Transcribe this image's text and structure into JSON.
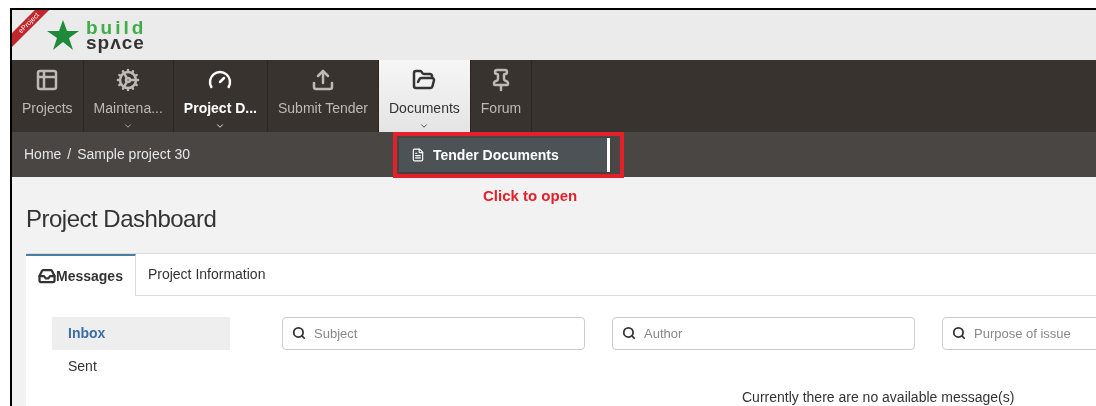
{
  "logo": {
    "badge": "eProject",
    "line1": "build",
    "line2": "spʌce"
  },
  "nav": [
    {
      "label": "Projects",
      "selected": false,
      "active": false,
      "caret": false
    },
    {
      "label": "Maintena...",
      "selected": false,
      "active": false,
      "caret": true
    },
    {
      "label": "Project D...",
      "selected": false,
      "active": true,
      "caret": true
    },
    {
      "label": "Submit Tender",
      "selected": false,
      "active": false,
      "caret": false
    },
    {
      "label": "Documents",
      "selected": true,
      "active": false,
      "caret": true
    },
    {
      "label": "Forum",
      "selected": false,
      "active": false,
      "caret": false
    }
  ],
  "breadcrumb": {
    "items": [
      "Home",
      "Sample project 30"
    ],
    "separator": "/"
  },
  "dropdown": {
    "items": [
      "Tender Documents"
    ]
  },
  "annotation": "Click to open",
  "page_title": "Project Dashboard",
  "tabs": [
    {
      "label": "Messages",
      "selected": true
    },
    {
      "label": "Project Information",
      "selected": false
    }
  ],
  "folders": [
    {
      "label": "Inbox",
      "selected": true
    },
    {
      "label": "Sent",
      "selected": false
    }
  ],
  "filters": [
    {
      "placeholder": "Subject"
    },
    {
      "placeholder": "Author"
    },
    {
      "placeholder": "Purpose of issue"
    }
  ],
  "empty_message": "Currently there are no available message(s)"
}
